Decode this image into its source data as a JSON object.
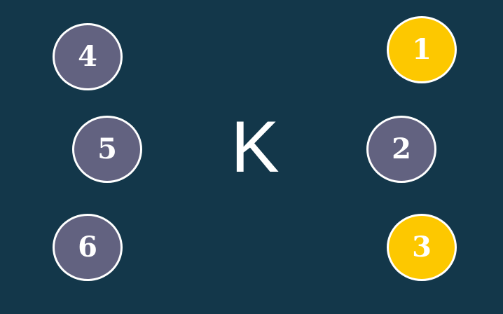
{
  "center_letter": "K",
  "colors": {
    "background": "#13374a",
    "selected": "#fdc800",
    "unselected": "#626280",
    "border": "#ffffff",
    "text": "#ffffff"
  },
  "dots": [
    {
      "label": "1",
      "selected": true
    },
    {
      "label": "2",
      "selected": false
    },
    {
      "label": "3",
      "selected": true
    },
    {
      "label": "4",
      "selected": false
    },
    {
      "label": "5",
      "selected": false
    },
    {
      "label": "6",
      "selected": false
    }
  ]
}
